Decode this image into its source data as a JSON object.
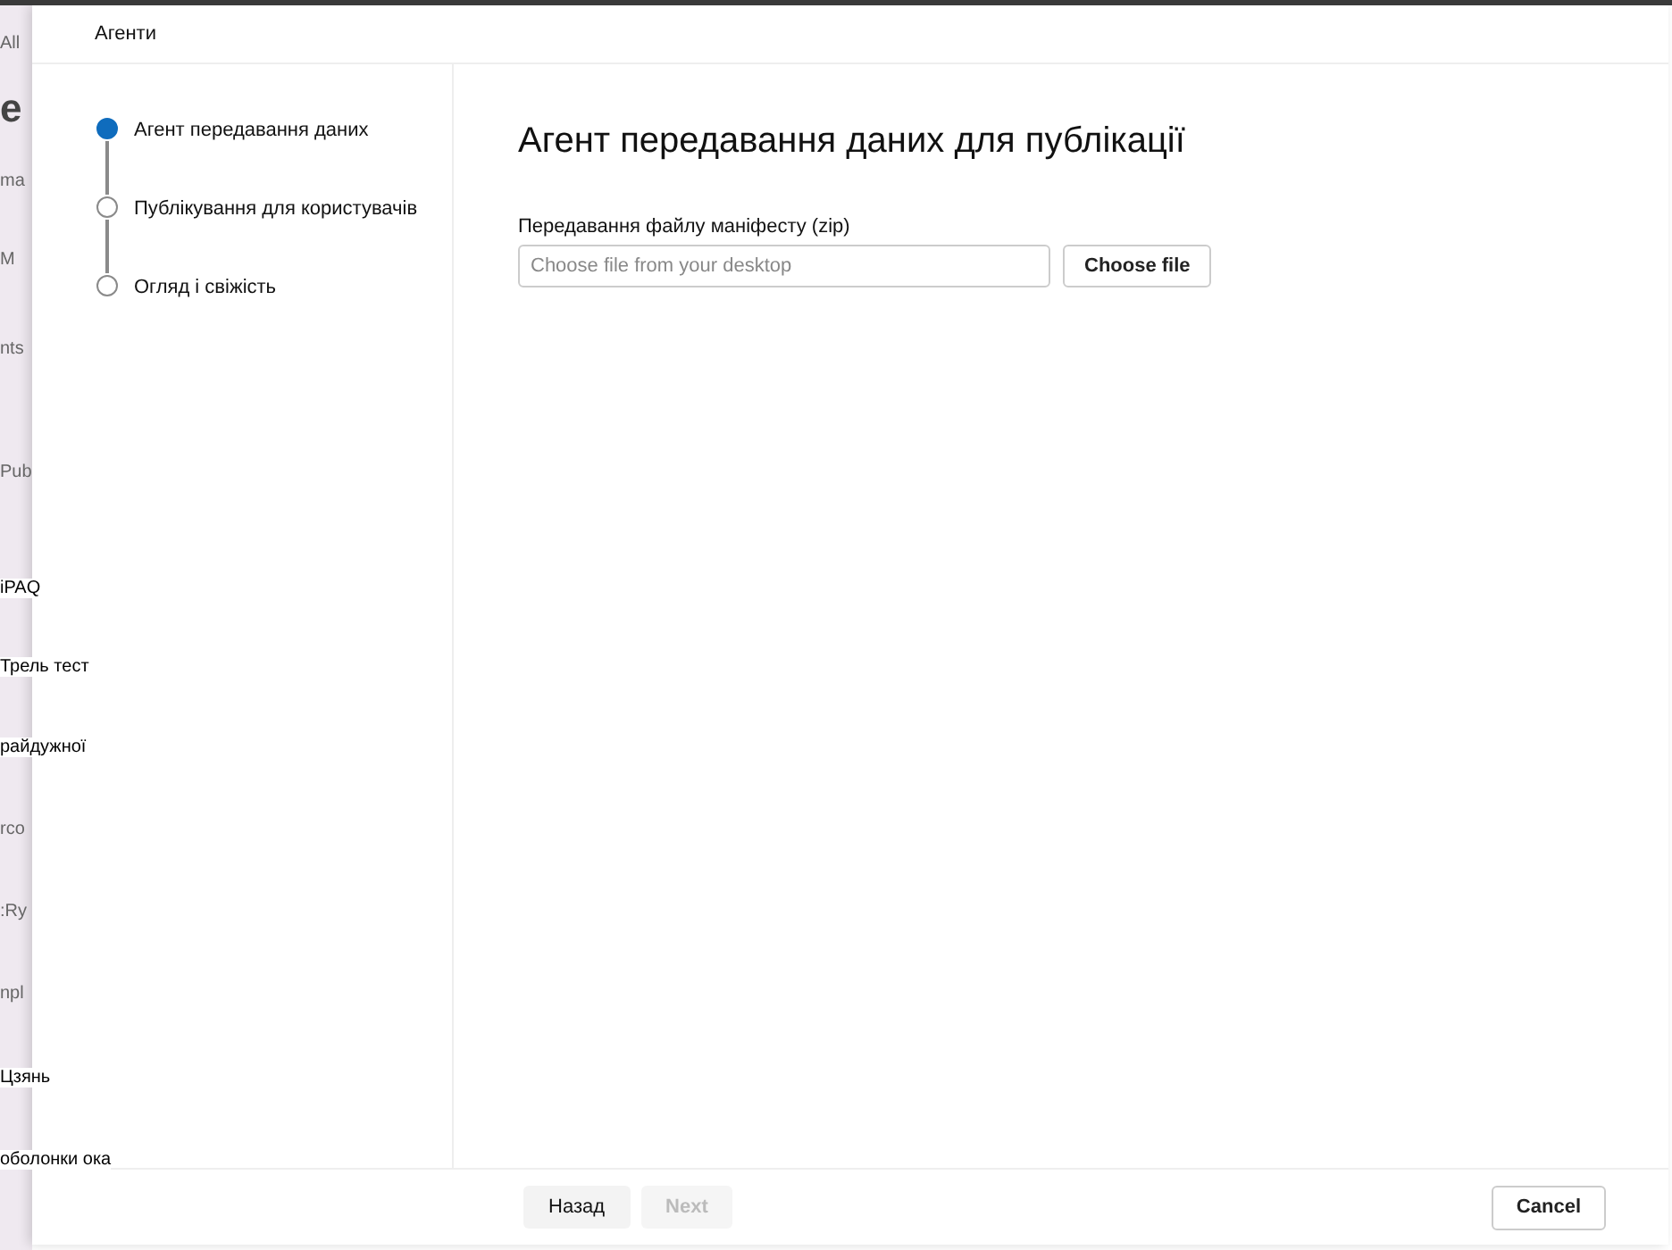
{
  "background_page": {
    "items": [
      {
        "text": "All",
        "kind": "behind"
      },
      {
        "text": "e",
        "kind": "heading"
      },
      {
        "text": "ma",
        "kind": "behind"
      },
      {
        "text": "M",
        "kind": "behind"
      },
      {
        "text": "nts",
        "kind": "behind"
      },
      {
        "text": "Pub",
        "kind": "behind"
      },
      {
        "text": "iPAQ",
        "kind": "overlay"
      },
      {
        "text": "Трель тест",
        "kind": "overlay"
      },
      {
        "text": "райдужної",
        "kind": "overlay"
      },
      {
        "text": "rco",
        "kind": "behind"
      },
      {
        "text": ":Ry",
        "kind": "behind"
      },
      {
        "text": "npl",
        "kind": "behind"
      },
      {
        "text": "Цзянь",
        "kind": "overlay"
      },
      {
        "text": "оболонки ока",
        "kind": "overlay"
      }
    ]
  },
  "panel": {
    "title": "Агенти",
    "steps": [
      {
        "label": "Агент передавання даних",
        "selected": true
      },
      {
        "label": "Публікування для користувачів",
        "selected": false
      },
      {
        "label": "Огляд і свіжість",
        "selected": false
      }
    ],
    "heading": "Агент передавання даних для публікації",
    "upload": {
      "label": "Передавання файлу маніфесту (zip)",
      "placeholder": "Choose file from your desktop",
      "button": "Choose file"
    },
    "footer": {
      "back": {
        "label": "Назад",
        "disabled": false
      },
      "next": {
        "label": "Next",
        "disabled": true
      },
      "cancel": "Cancel"
    }
  }
}
